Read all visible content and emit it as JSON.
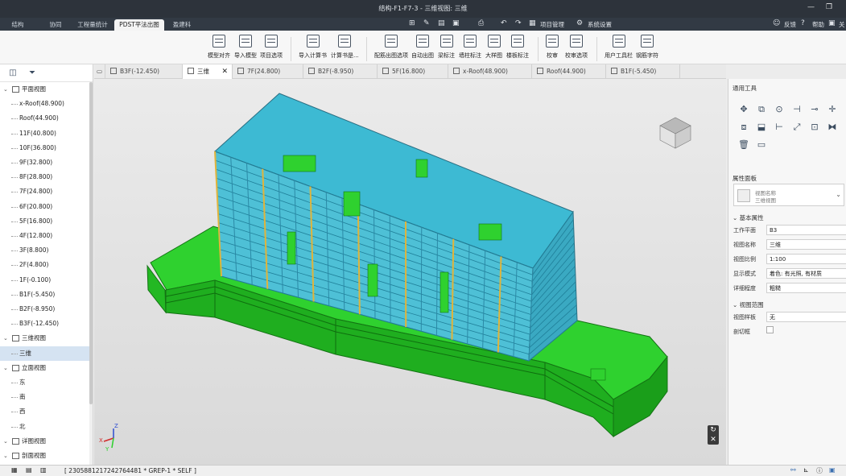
{
  "window": {
    "title": "结构-F1-F7-3 - 三维视图: 三维"
  },
  "main_tabs": [
    {
      "label": "结构"
    },
    {
      "label": "协同"
    },
    {
      "label": "工程量统计"
    },
    {
      "label": "PDST平法出图"
    },
    {
      "label": "盈建科"
    }
  ],
  "quick_access": {
    "project_mgmt": "项目管理",
    "system_settings": "系统设置",
    "feedback": "反馈",
    "help": "帮助",
    "close_label": "关"
  },
  "ribbon": {
    "buttons": [
      {
        "label": "模型对齐"
      },
      {
        "label": "导入模型"
      },
      {
        "label": "项目选项"
      },
      {
        "label": "导入计算书"
      },
      {
        "label": "计算书是..."
      },
      {
        "label": "配筋出图选项"
      },
      {
        "label": "自动出图"
      },
      {
        "label": "梁标注"
      },
      {
        "label": "墙柱标注"
      },
      {
        "label": "大样图"
      },
      {
        "label": "楼板标注"
      },
      {
        "label": "校审"
      },
      {
        "label": "校审选项"
      },
      {
        "label": "用户工具栏"
      },
      {
        "label": "钢筋字符"
      }
    ]
  },
  "tree": [
    {
      "label": "平面视图",
      "level": 0,
      "type": "group"
    },
    {
      "label": "x-Roof(48.900)",
      "level": 1
    },
    {
      "label": "Roof(44.900)",
      "level": 1
    },
    {
      "label": "11F(40.800)",
      "level": 1
    },
    {
      "label": "10F(36.800)",
      "level": 1
    },
    {
      "label": "9F(32.800)",
      "level": 1
    },
    {
      "label": "8F(28.800)",
      "level": 1
    },
    {
      "label": "7F(24.800)",
      "level": 1
    },
    {
      "label": "6F(20.800)",
      "level": 1
    },
    {
      "label": "5F(16.800)",
      "level": 1
    },
    {
      "label": "4F(12.800)",
      "level": 1
    },
    {
      "label": "3F(8.800)",
      "level": 1
    },
    {
      "label": "2F(4.800)",
      "level": 1
    },
    {
      "label": "1F(-0.100)",
      "level": 1
    },
    {
      "label": "B1F(-5.450)",
      "level": 1
    },
    {
      "label": "B2F(-8.950)",
      "level": 1
    },
    {
      "label": "B3F(-12.450)",
      "level": 1
    },
    {
      "label": "三维视图",
      "level": 0,
      "type": "group"
    },
    {
      "label": "三维",
      "level": 1,
      "selected": true
    },
    {
      "label": "立面视图",
      "level": 0,
      "type": "group"
    },
    {
      "label": "东",
      "level": 1
    },
    {
      "label": "南",
      "level": 1
    },
    {
      "label": "西",
      "level": 1
    },
    {
      "label": "北",
      "level": 1
    },
    {
      "label": "详图视图",
      "level": 0,
      "type": "group"
    },
    {
      "label": "剖面视图",
      "level": 0,
      "type": "group"
    }
  ],
  "view_tabs": [
    {
      "label": "B3F(-12.450)"
    },
    {
      "label": "三维",
      "active": true
    },
    {
      "label": "7F(24.800)"
    },
    {
      "label": "B2F(-8.950)"
    },
    {
      "label": "5F(16.800)"
    },
    {
      "label": "x-Roof(48.900)"
    },
    {
      "label": "Roof(44.900)"
    },
    {
      "label": "B1F(-5.450)"
    }
  ],
  "right_panel": {
    "tools_title": "通用工具",
    "props_title": "属性面板",
    "type_selector": {
      "line1": "视图名称",
      "line2": "三维视图"
    },
    "basic_title": "基本属性",
    "props": [
      {
        "label": "工作平面",
        "value": "B3"
      },
      {
        "label": "视图名称",
        "value": "三维"
      },
      {
        "label": "视图比例",
        "value": "1:100"
      },
      {
        "label": "显示模式",
        "value": "着色: 有光照, 有材质"
      },
      {
        "label": "详细程度",
        "value": "粗糙"
      }
    ],
    "range_title": "视图范围",
    "range_props": [
      {
        "label": "视图样板",
        "value": "无"
      },
      {
        "label": "剖切框",
        "value": ""
      }
    ]
  },
  "statusbar": {
    "text": "[ 2305881217242764481 * GREP-1 * SELF ]"
  },
  "axes": {
    "x": "X",
    "y": "Y",
    "z": "Z"
  },
  "colors": {
    "beam": "#3fb3d8",
    "column": "#d9a83b",
    "slab": "#22c722",
    "titlebar": "#2d333b",
    "accent": "#3b6fb0"
  }
}
